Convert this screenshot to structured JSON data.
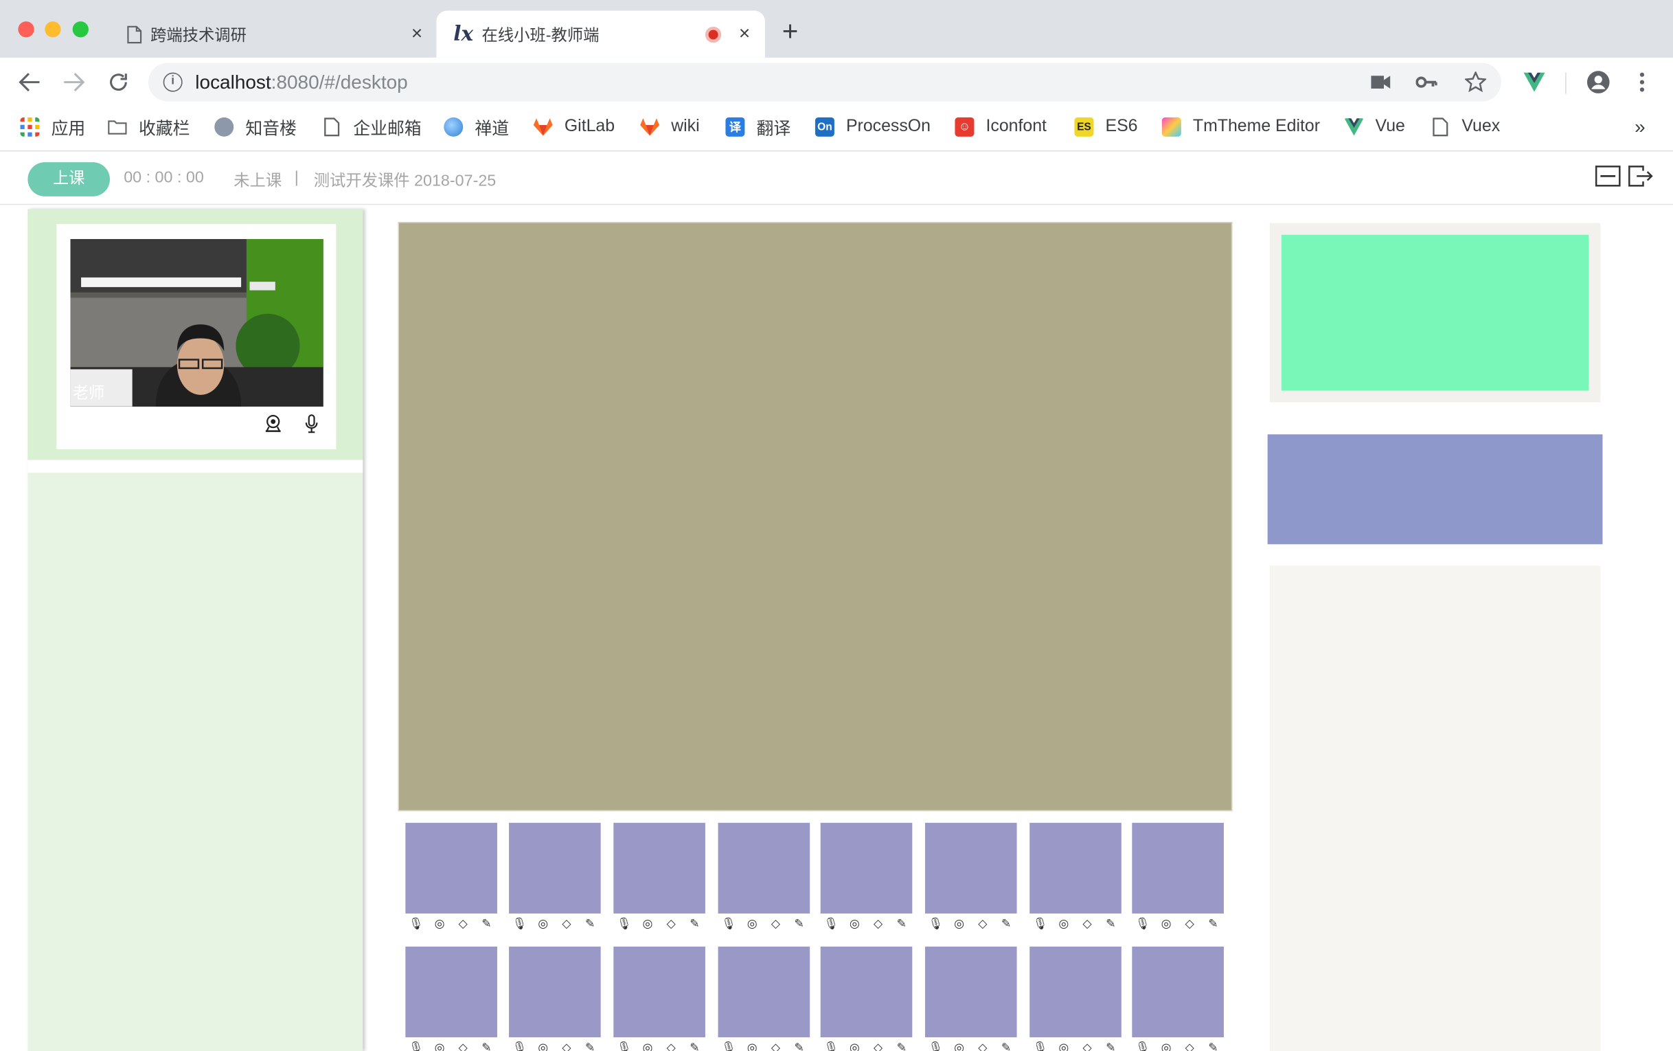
{
  "browser": {
    "tabs": [
      {
        "title": "跨端技术调研",
        "close": "×"
      },
      {
        "title": "在线小班-教师端",
        "close": "×"
      }
    ],
    "new_tab": "+",
    "url_host": "localhost",
    "url_rest": ":8080/#/desktop"
  },
  "bookmarks": [
    {
      "label": "应用"
    },
    {
      "label": "收藏栏"
    },
    {
      "label": "知音楼"
    },
    {
      "label": "企业邮箱"
    },
    {
      "label": "禅道"
    },
    {
      "label": "GitLab"
    },
    {
      "label": "wiki"
    },
    {
      "label": "翻译"
    },
    {
      "label": "ProcessOn"
    },
    {
      "label": "Iconfont"
    },
    {
      "label": "ES6"
    },
    {
      "label": "TmTheme Editor"
    },
    {
      "label": "Vue"
    },
    {
      "label": "Vuex"
    }
  ],
  "bookmarks_more": "»",
  "header": {
    "start_button": "上课",
    "timer": "00 : 00 : 00",
    "status": "未上课",
    "divider": "|",
    "course": "测试开发课件 2018-07-25"
  },
  "teacher": {
    "label": "老师"
  },
  "colors": {
    "accent": "#6fcbb1",
    "board": "#aeaa8a",
    "student_tile": "#9a98c7",
    "right_green": "#79f7b8",
    "right_purple": "#8f98cb"
  }
}
